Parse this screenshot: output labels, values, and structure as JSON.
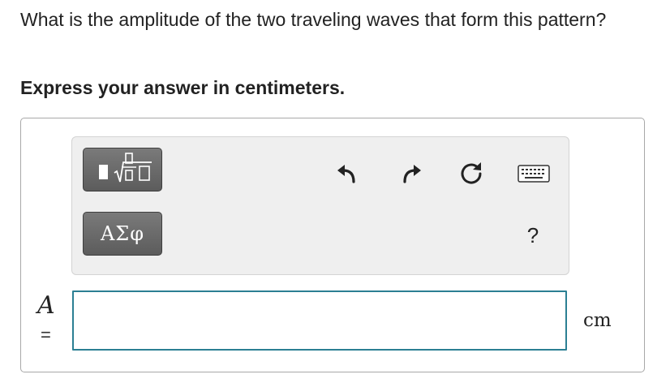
{
  "question": {
    "text": "What is the amplitude of the two traveling waves that form this pattern?",
    "instruction": "Express your answer in centimeters."
  },
  "toolbar": {
    "template_button_icon": "fraction-sqrt-template-icon",
    "greek_label": "ΑΣφ",
    "undo_icon": "undo-icon",
    "redo_icon": "redo-icon",
    "reset_icon": "reset-icon",
    "keyboard_icon": "keyboard-icon",
    "help_label": "?"
  },
  "answer": {
    "variable": "A",
    "equals": "=",
    "value": "",
    "unit": "cm"
  },
  "colors": {
    "input_border": "#2b7f93",
    "template_button": "#6a6a6a",
    "toolbar_bg": "#efefef"
  }
}
